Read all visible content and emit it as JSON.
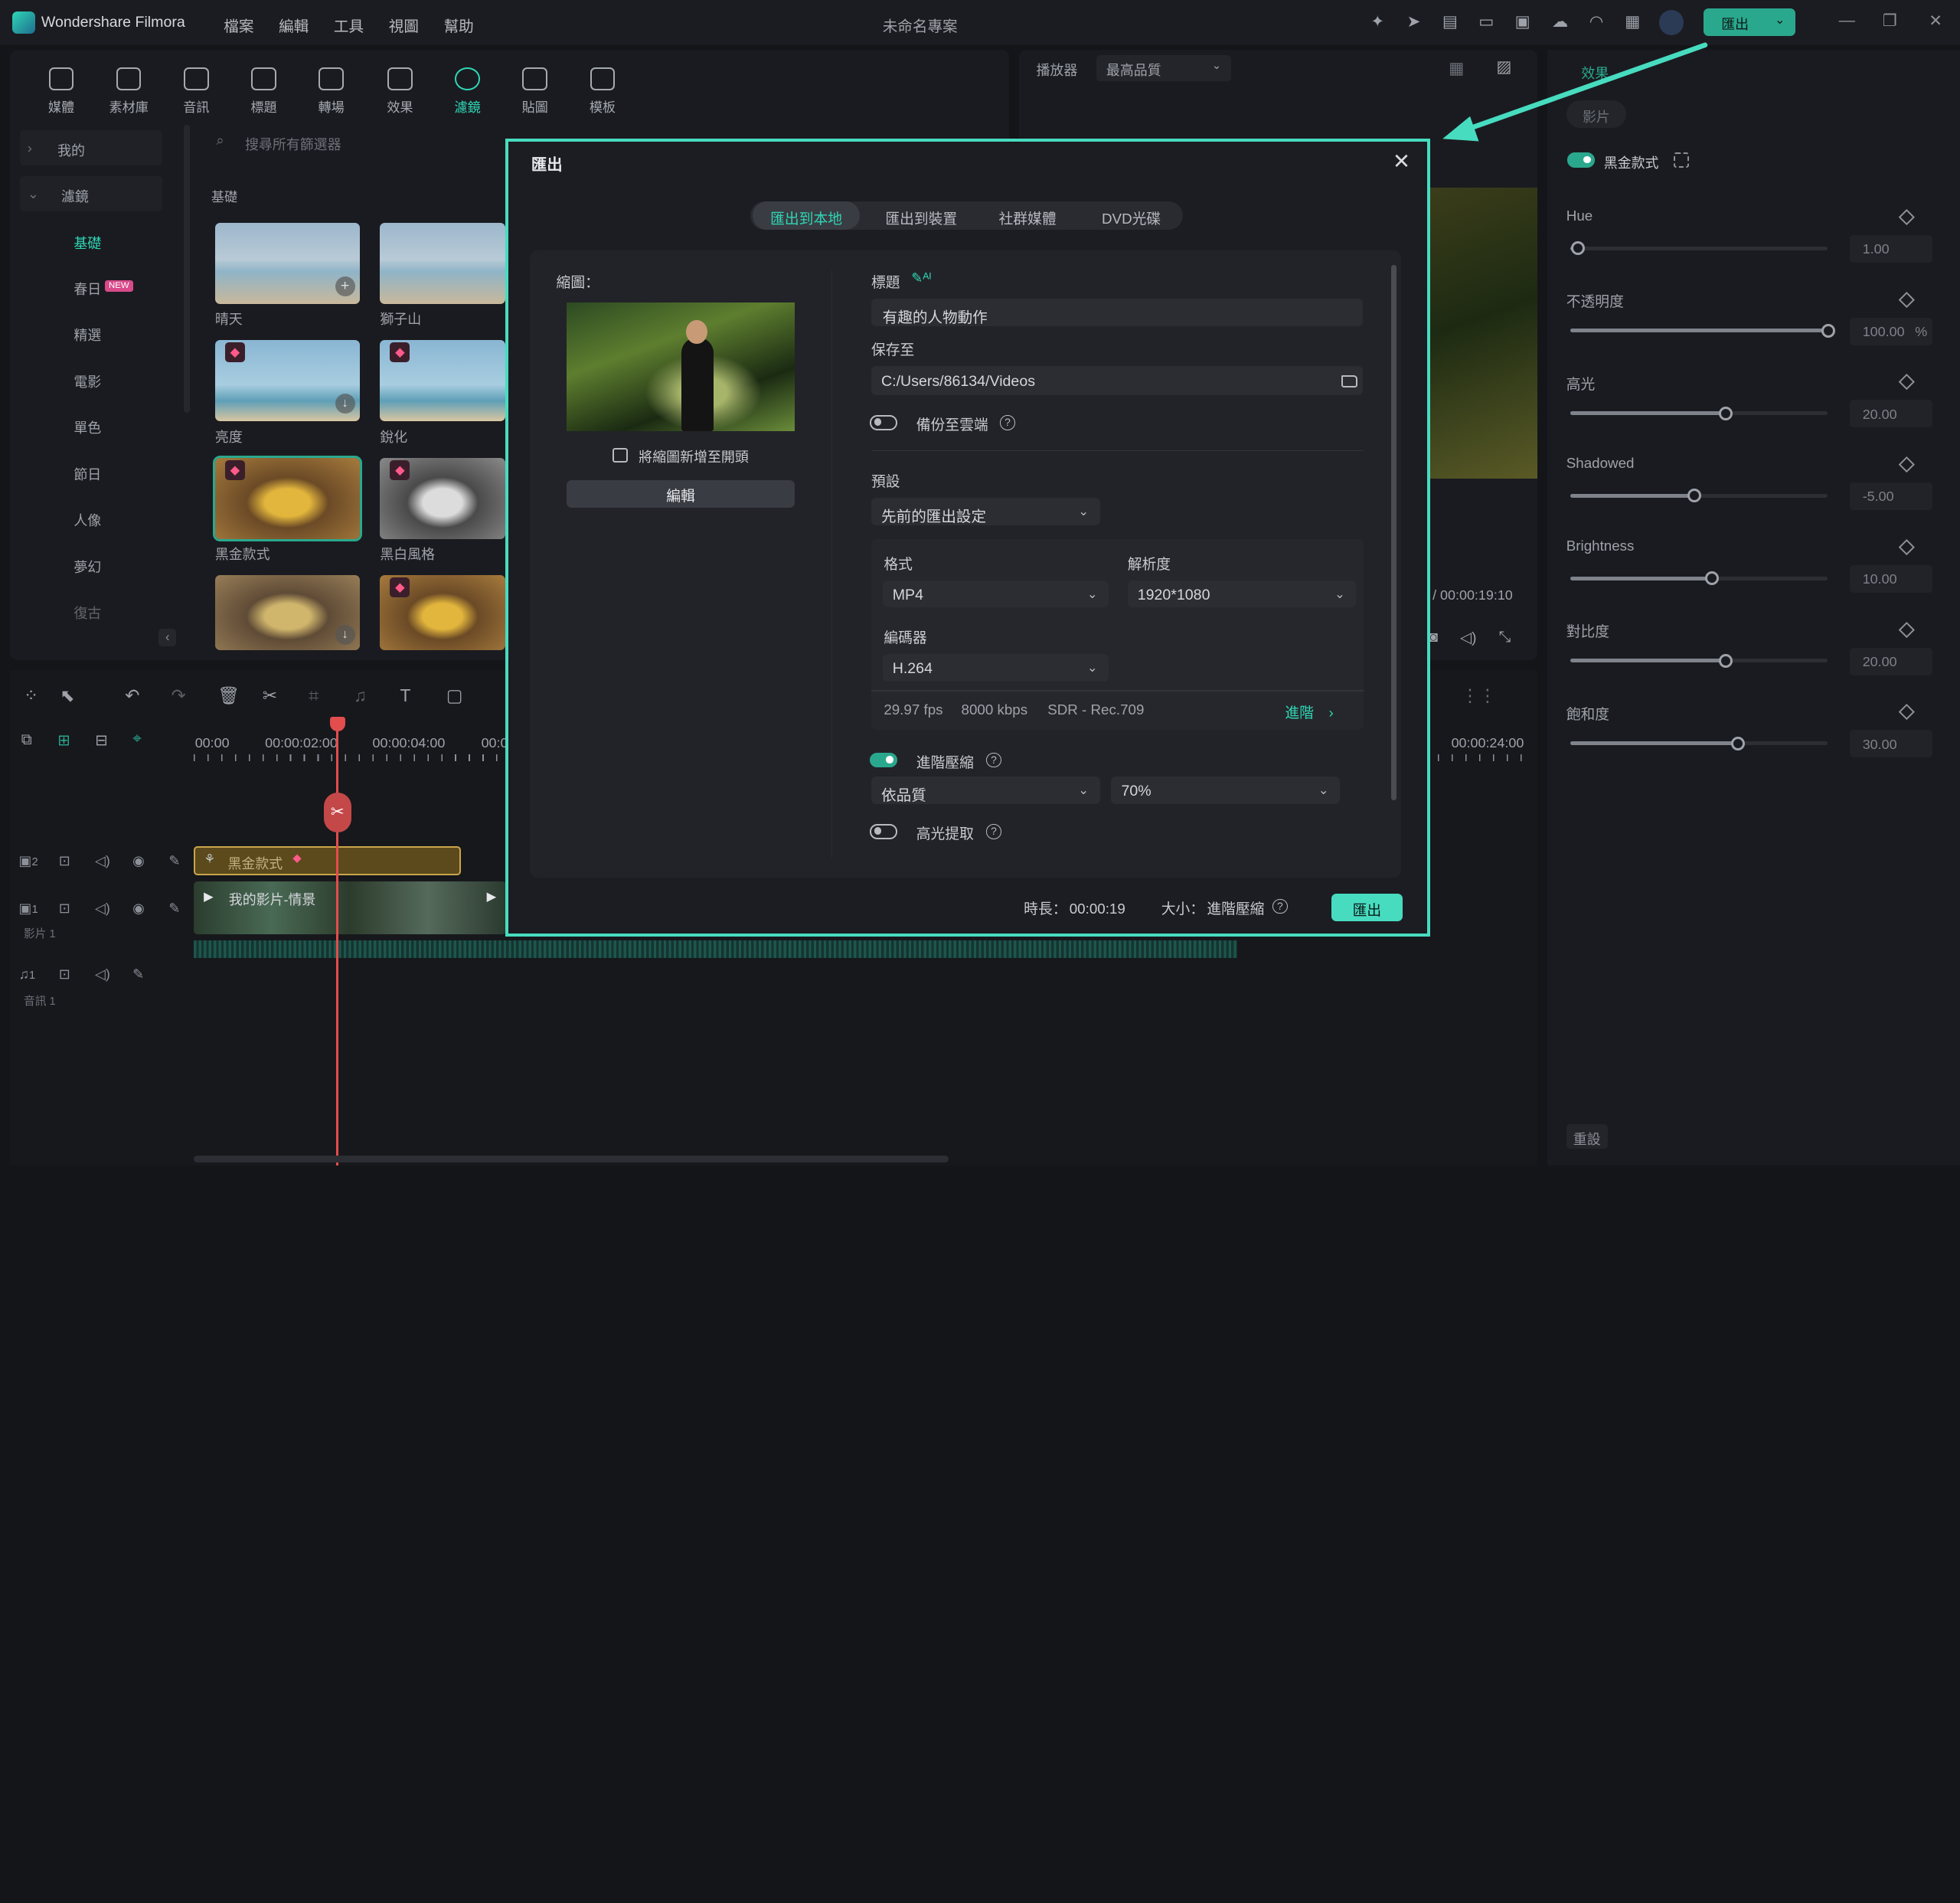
{
  "app": {
    "name": "Wondershare Filmora",
    "menu": [
      "檔案",
      "編輯",
      "工具",
      "視圖",
      "幫助"
    ],
    "project_title": "未命名專案",
    "export_button": "匯出"
  },
  "top_tabs": [
    "媒體",
    "素材庫",
    "音訊",
    "標題",
    "轉場",
    "效果",
    "濾鏡",
    "貼圖",
    "模板"
  ],
  "top_tabs_active": "濾鏡",
  "sidebar": {
    "items": [
      {
        "label": "我的",
        "type": "section"
      },
      {
        "label": "濾鏡",
        "type": "section"
      },
      {
        "label": "基礎",
        "type": "active"
      },
      {
        "label": "春日",
        "type": "item",
        "badge": "NEW"
      },
      {
        "label": "精選",
        "type": "item"
      },
      {
        "label": "電影",
        "type": "item"
      },
      {
        "label": "單色",
        "type": "item"
      },
      {
        "label": "節日",
        "type": "item"
      },
      {
        "label": "人像",
        "type": "item"
      },
      {
        "label": "夢幻",
        "type": "item"
      },
      {
        "label": "復古",
        "type": "item"
      }
    ]
  },
  "browser": {
    "search_placeholder": "搜尋所有篩選器",
    "section_title": "基礎",
    "thumbs": [
      {
        "label": "晴天"
      },
      {
        "label": "獅子山"
      },
      {
        "label": "亮度"
      },
      {
        "label": "銳化"
      },
      {
        "label": "黑金款式"
      },
      {
        "label": "黑白風格"
      },
      {
        "label": ""
      },
      {
        "label": ""
      }
    ]
  },
  "player": {
    "label": "播放器",
    "quality": "最高品質",
    "time": "/ 00:00:19:10"
  },
  "properties": {
    "tabs": [
      "效果",
      "影片"
    ],
    "filter_name": "黑金款式",
    "sliders": [
      {
        "label": "Hue",
        "value": "1.00",
        "fraction": 0.03
      },
      {
        "label": "不透明度",
        "value": "100.00",
        "unit": "%",
        "fraction": 1.0
      },
      {
        "label": "高光",
        "value": "20.00",
        "fraction": 0.6
      },
      {
        "label": "Shadowed",
        "value": "-5.00",
        "fraction": 0.48
      },
      {
        "label": "Brightness",
        "value": "10.00",
        "fraction": 0.55
      },
      {
        "label": "對比度",
        "value": "20.00",
        "fraction": 0.6
      },
      {
        "label": "飽和度",
        "value": "30.00",
        "fraction": 0.65
      }
    ],
    "reset": "重設"
  },
  "timeline": {
    "ruler": [
      "00:00",
      "00:00:02:00",
      "00:00:04:00",
      "00:0",
      "00:00:24:00"
    ],
    "effect_clip": "黑金款式",
    "video_clip": "我的影片-情景",
    "track_video_label": "影片 1",
    "track_audio_label": "音訊 1",
    "track_numbers": [
      "2",
      "1",
      "1"
    ]
  },
  "dialog": {
    "title": "匯出",
    "tabs": [
      "匯出到本地",
      "匯出到裝置",
      "社群媒體",
      "DVD光碟"
    ],
    "active_tab": "匯出到本地",
    "thumbnail_label": "縮圖：",
    "add_thumbnail_to_start": "將縮圖新增至開頭",
    "edit_button": "編輯",
    "name_label": "標題",
    "name_value": "有趣的人物動作",
    "save_to_label": "保存至",
    "save_to_value": "C:/Users/86134/Videos",
    "backup_label": "備份至雲端",
    "preset_label": "預設",
    "preset_value": "先前的匯出設定",
    "format_label": "格式",
    "format_value": "MP4",
    "resolution_label": "解析度",
    "resolution_value": "1920*1080",
    "encoder_label": "編碼器",
    "encoder_value": "H.264",
    "fps": "29.97 fps",
    "bitrate": "8000 kbps",
    "color": "SDR - Rec.709",
    "advanced": "進階",
    "adv_compress_label": "進階壓縮",
    "quality_mode": "依品質",
    "quality_percent": "70%",
    "highlight_label": "高光提取",
    "duration_label": "時長：",
    "duration_value": "00:00:19",
    "size_label": "大小：",
    "size_value": "進階壓縮",
    "export_button": "匯出"
  }
}
